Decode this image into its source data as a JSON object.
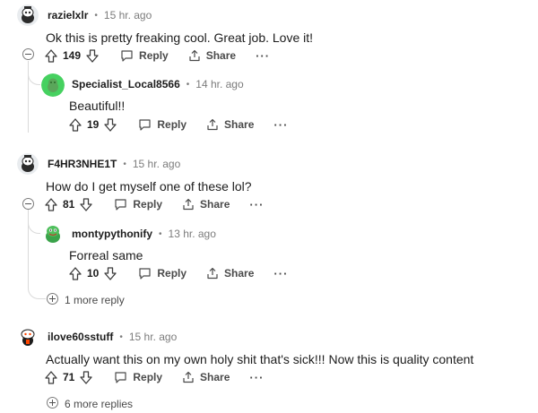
{
  "comments": [
    {
      "username": "razielxlr",
      "time": "15 hr. ago",
      "text": "Ok this is pretty freaking cool. Great job. Love it!",
      "votes": "149",
      "reply_label": "Reply",
      "share_label": "Share",
      "more_label": "···",
      "replies": [
        {
          "username": "Specialist_Local8566",
          "time": "14 hr. ago",
          "text": "Beautiful!!",
          "votes": "19",
          "reply_label": "Reply",
          "share_label": "Share",
          "more_label": "···"
        }
      ]
    },
    {
      "username": "F4HR3NHE1T",
      "time": "15 hr. ago",
      "text": "How do I get myself one of these lol?",
      "votes": "81",
      "reply_label": "Reply",
      "share_label": "Share",
      "more_label": "···",
      "replies": [
        {
          "username": "montypythonify",
          "time": "13 hr. ago",
          "text": "Forreal same",
          "votes": "10",
          "reply_label": "Reply",
          "share_label": "Share",
          "more_label": "···"
        }
      ],
      "more_replies": "1 more reply"
    },
    {
      "username": "ilove60sstuff",
      "time": "15 hr. ago",
      "text": "Actually want this on my own holy shit that's sick!!! Now this is quality content",
      "votes": "71",
      "reply_label": "Reply",
      "share_label": "Share",
      "more_label": "···",
      "more_replies": "6 more replies"
    }
  ],
  "separator": "•",
  "icons": {
    "upvote": "upvote-arrow-icon",
    "downvote": "downvote-arrow-icon",
    "reply": "reply-bubble-icon",
    "share": "share-icon",
    "collapse": "collapse-thread-icon",
    "expand": "expand-replies-icon"
  },
  "colors": {
    "username": "#1c1c1c",
    "meta": "#7c7c7c",
    "thread_line": "#dadada",
    "avatar_green": "#46d160"
  }
}
